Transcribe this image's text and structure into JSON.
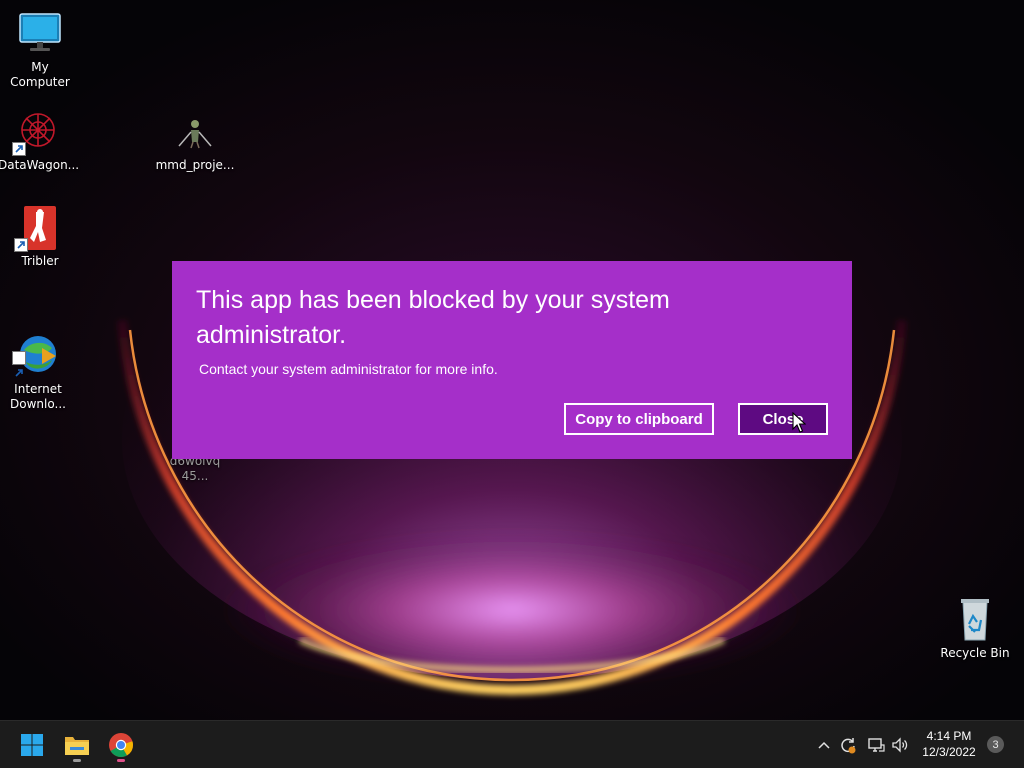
{
  "desktop": {
    "icons": [
      {
        "label": "My Computer",
        "icon": "monitor-icon"
      },
      {
        "label": "DataWagon...",
        "icon": "datawagon-icon"
      },
      {
        "label": "mmd_proje...",
        "icon": "mmd-figure-icon"
      },
      {
        "label": "Tribler",
        "icon": "tribler-icon"
      },
      {
        "label": "Internet\nDownlo...",
        "icon": "internet-download-manager-icon"
      },
      {
        "label": "d6wolvq 45...",
        "icon": "file-icon"
      },
      {
        "label": "Recycle Bin",
        "icon": "recycle-bin-icon"
      }
    ]
  },
  "dialog": {
    "title": "This app has been blocked by your system administrator.",
    "message": "Contact your system administrator for more info.",
    "copy_label": "Copy to clipboard",
    "close_label": "Close",
    "colors": {
      "background": "#a52fc9",
      "close_button": "#5e0a82"
    }
  },
  "taskbar": {
    "apps": [
      {
        "name": "start",
        "icon": "windows-logo-icon"
      },
      {
        "name": "file-explorer",
        "icon": "folder-icon"
      },
      {
        "name": "chrome",
        "icon": "chrome-icon"
      }
    ],
    "tray": [
      "chevron-up-icon",
      "sync-icon",
      "network-icon",
      "volume-icon"
    ],
    "time": "4:14 PM",
    "date": "12/3/2022",
    "notification_count": "3"
  }
}
